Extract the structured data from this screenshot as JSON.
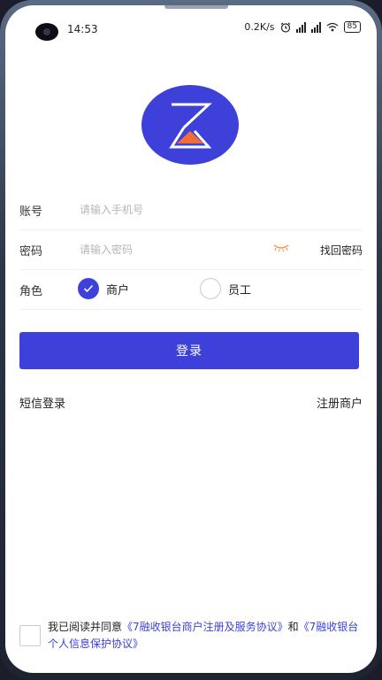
{
  "status_bar": {
    "time": "14:53",
    "net_speed": "0.2K/s",
    "battery": "85",
    "icons": [
      "alarm-icon",
      "signal-icon",
      "signal-hd-icon",
      "wifi-icon",
      "battery-icon"
    ]
  },
  "logo": {
    "icon": "hourglass-logo-icon",
    "bg_color": "#3d41d9",
    "accent_color": "#f26b3a"
  },
  "form": {
    "account": {
      "label": "账号",
      "placeholder": "请输入手机号",
      "value": ""
    },
    "password": {
      "label": "密码",
      "placeholder": "请输入密码",
      "value": "",
      "eye_icon": "eye-closed-icon",
      "forgot_label": "找回密码"
    },
    "role": {
      "label": "角色",
      "options": [
        {
          "label": "商户",
          "selected": true
        },
        {
          "label": "员工",
          "selected": false
        }
      ]
    }
  },
  "login_button": {
    "label": "登录",
    "color": "#3d41d9"
  },
  "links": {
    "sms_login": "短信登录",
    "register": "注册商户"
  },
  "agreement": {
    "checked": false,
    "prefix": "我已阅读并同意",
    "link1": "《7融收银台商户注册及服务协议》",
    "and": "和",
    "link2": "《7融收银台个人信息保护协议》"
  }
}
